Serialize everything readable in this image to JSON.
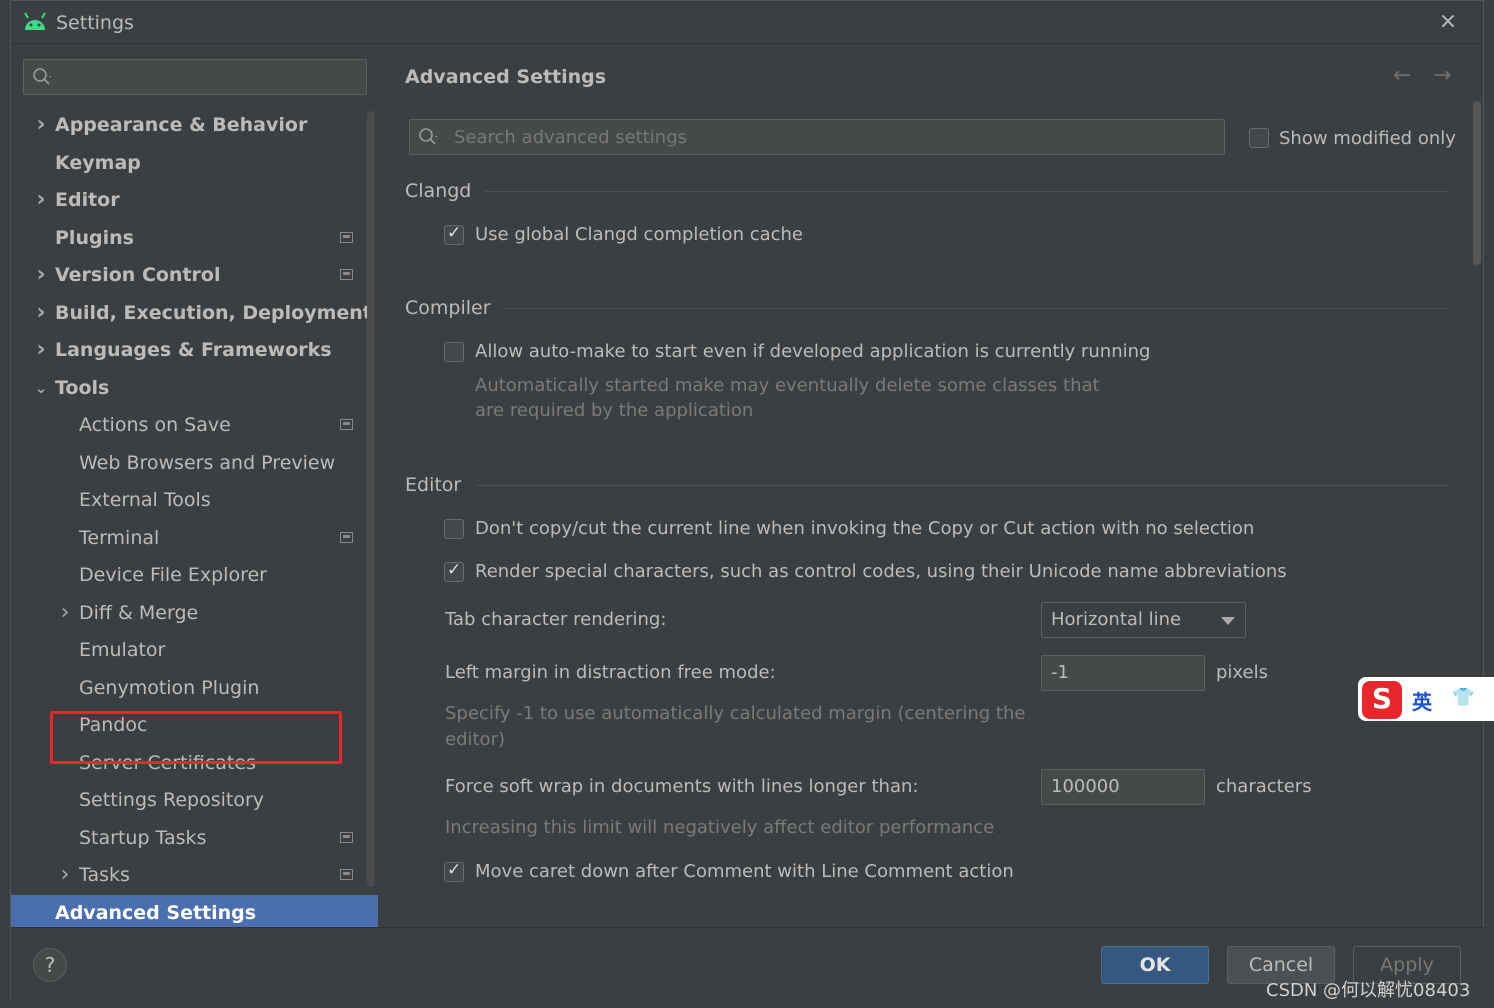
{
  "window": {
    "title": "Settings",
    "close_icon": "×"
  },
  "sidebar": {
    "search_placeholder": "",
    "items": [
      {
        "label": "Appearance & Behavior",
        "bold": true,
        "level": 0,
        "expandable": "collapsed",
        "page_icon": false
      },
      {
        "label": "Keymap",
        "bold": true,
        "level": 0,
        "expandable": "none",
        "page_icon": false
      },
      {
        "label": "Editor",
        "bold": true,
        "level": 0,
        "expandable": "collapsed",
        "page_icon": false
      },
      {
        "label": "Plugins",
        "bold": true,
        "level": 0,
        "expandable": "none",
        "page_icon": true
      },
      {
        "label": "Version Control",
        "bold": true,
        "level": 0,
        "expandable": "collapsed",
        "page_icon": true
      },
      {
        "label": "Build, Execution, Deployment",
        "bold": true,
        "level": 0,
        "expandable": "collapsed",
        "page_icon": false
      },
      {
        "label": "Languages & Frameworks",
        "bold": true,
        "level": 0,
        "expandable": "collapsed",
        "page_icon": false
      },
      {
        "label": "Tools",
        "bold": true,
        "level": 0,
        "expandable": "expanded",
        "page_icon": false
      },
      {
        "label": "Actions on Save",
        "bold": false,
        "level": 1,
        "expandable": "none",
        "page_icon": true
      },
      {
        "label": "Web Browsers and Preview",
        "bold": false,
        "level": 1,
        "expandable": "none",
        "page_icon": false
      },
      {
        "label": "External Tools",
        "bold": false,
        "level": 1,
        "expandable": "none",
        "page_icon": false
      },
      {
        "label": "Terminal",
        "bold": false,
        "level": 1,
        "expandable": "none",
        "page_icon": true
      },
      {
        "label": "Device File Explorer",
        "bold": false,
        "level": 1,
        "expandable": "none",
        "page_icon": false
      },
      {
        "label": "Diff & Merge",
        "bold": false,
        "level": 1,
        "expandable": "collapsed",
        "page_icon": false
      },
      {
        "label": "Emulator",
        "bold": false,
        "level": 1,
        "expandable": "none",
        "page_icon": false
      },
      {
        "label": "Genymotion Plugin",
        "bold": false,
        "level": 1,
        "expandable": "none",
        "page_icon": false
      },
      {
        "label": "Pandoc",
        "bold": false,
        "level": 1,
        "expandable": "none",
        "page_icon": false
      },
      {
        "label": "Server Certificates",
        "bold": false,
        "level": 1,
        "expandable": "none",
        "page_icon": false
      },
      {
        "label": "Settings Repository",
        "bold": false,
        "level": 1,
        "expandable": "none",
        "page_icon": false
      },
      {
        "label": "Startup Tasks",
        "bold": false,
        "level": 1,
        "expandable": "none",
        "page_icon": true
      },
      {
        "label": "Tasks",
        "bold": false,
        "level": 1,
        "expandable": "collapsed",
        "page_icon": true
      },
      {
        "label": "Advanced Settings",
        "bold": true,
        "level": 0,
        "expandable": "none",
        "page_icon": false,
        "selected": true
      }
    ]
  },
  "main": {
    "title": "Advanced Settings",
    "search_placeholder": "Search advanced settings",
    "show_modified_label": "Show modified only",
    "show_modified_checked": false,
    "sections": {
      "clangd": {
        "title": "Clangd",
        "global_cache_label": "Use global Clangd completion cache",
        "global_cache_checked": true
      },
      "compiler": {
        "title": "Compiler",
        "automake_label": "Allow auto-make to start even if developed application is currently running",
        "automake_checked": false,
        "automake_hint_1": "Automatically started make may eventually delete some classes that",
        "automake_hint_2": "are required by the application"
      },
      "editor": {
        "title": "Editor",
        "no_copy_label": "Don't copy/cut the current line when invoking the Copy or Cut action with no selection",
        "no_copy_checked": false,
        "render_special_label": "Render special characters, such as control codes, using their Unicode name abbreviations",
        "render_special_checked": true,
        "tab_render_label": "Tab character rendering:",
        "tab_render_value": "Horizontal line",
        "left_margin_label": "Left margin in distraction free mode:",
        "left_margin_value": "-1",
        "left_margin_unit": "pixels",
        "left_margin_hint_1": "Specify -1 to use automatically calculated margin (centering the",
        "left_margin_hint_2": "editor)",
        "soft_wrap_label": "Force soft wrap in documents with lines longer than:",
        "soft_wrap_value": "100000",
        "soft_wrap_unit": "characters",
        "soft_wrap_hint": "Increasing this limit will negatively affect editor performance",
        "caret_down_label": "Move caret down after Comment with Line Comment action",
        "caret_down_checked": true
      }
    }
  },
  "footer": {
    "help": "?",
    "ok": "OK",
    "cancel": "Cancel",
    "apply": "Apply"
  },
  "overlay": {
    "ime_logo": "S",
    "ime_lang": "英",
    "watermark": "CSDN @何以解忧08403"
  },
  "colors": {
    "background": "#3c3f41",
    "selection": "#4b6eaf",
    "highlight_box": "#e8262c",
    "ok_button": "#365880"
  }
}
